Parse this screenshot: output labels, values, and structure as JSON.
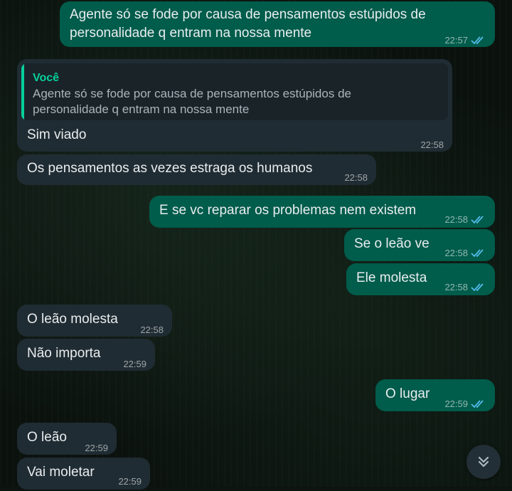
{
  "messages": [
    {
      "dir": "out",
      "text": "Agente só se fode por causa de pensamentos estúpidos de\npersonalidade q entram na nossa mente",
      "time": "22:57"
    },
    {
      "dir": "in",
      "reply": {
        "author": "Você",
        "text": "Agente só se fode por causa de pensamentos estúpidos de\npersonalidade q entram na nossa mente"
      },
      "text": "Sim viado",
      "time": "22:58"
    },
    {
      "dir": "in",
      "text": "Os pensamentos as vezes estraga os humanos",
      "time": "22:58"
    },
    {
      "dir": "out",
      "text": "E se vc reparar os problemas nem existem",
      "time": "22:58"
    },
    {
      "dir": "out",
      "text": "Se o leão ve",
      "time": "22:58"
    },
    {
      "dir": "out",
      "text": "Ele molesta",
      "time": "22:58"
    },
    {
      "dir": "in",
      "text": "O leão molesta",
      "time": "22:58"
    },
    {
      "dir": "in",
      "text": "Não importa",
      "time": "22:59"
    },
    {
      "dir": "out",
      "text": "O lugar",
      "time": "22:59"
    },
    {
      "dir": "in",
      "text": "O leão",
      "time": "22:59"
    },
    {
      "dir": "in",
      "text": "Vai moletar",
      "time": "22:59"
    }
  ],
  "colors": {
    "outgoing_bubble": "#005c4b",
    "incoming_bubble": "#202c33",
    "read_check": "#53bdeb",
    "quote_accent": "#06cf9c"
  },
  "icons": {
    "read_receipt": "double-check-icon",
    "scroll_down": "double-chevron-down-icon"
  }
}
